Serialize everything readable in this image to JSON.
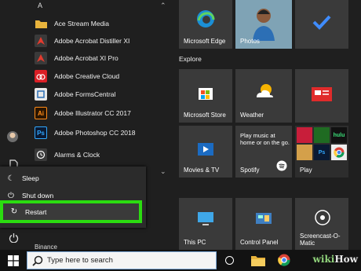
{
  "applist": {
    "letter": "A",
    "apps": [
      {
        "label": "Ace Stream Media",
        "icon": "folder-icon"
      },
      {
        "label": "Adobe Acrobat Distiller XI",
        "icon": "acrobat-distiller-icon"
      },
      {
        "label": "Adobe Acrobat XI Pro",
        "icon": "acrobat-icon"
      },
      {
        "label": "Adobe Creative Cloud",
        "icon": "creative-cloud-icon"
      },
      {
        "label": "Adobe FormsCentral",
        "icon": "forms-central-icon"
      },
      {
        "label": "Adobe Illustrator CC 2017",
        "icon": "illustrator-icon",
        "glyph": "Ai"
      },
      {
        "label": "Adobe Photoshop CC 2018",
        "icon": "photoshop-icon",
        "glyph": "Ps"
      },
      {
        "label": "Alarms & Clock",
        "icon": "alarm-clock-icon"
      }
    ],
    "binance": "Binance"
  },
  "power_menu": {
    "sleep": "Sleep",
    "shutdown": "Shut down",
    "restart": "Restart"
  },
  "tiles": {
    "explore": "Explore",
    "microsoft_edge": "Microsoft Edge",
    "photos": "Photos",
    "microsoft_store": "Microsoft Store",
    "weather": "Weather",
    "movies_tv": "Movies & TV",
    "spotify": "Spotify",
    "spotify_promo": "Play music at home or on the go.",
    "play": "Play",
    "this_pc": "This PC",
    "control_panel": "Control Panel",
    "screencast": "Screencast-O-Matic",
    "hulu": "hulu"
  },
  "taskbar": {
    "search_placeholder": "Type here to search"
  },
  "watermark": {
    "part1": "wiki",
    "part2": "How"
  },
  "colors": {
    "highlight": "#2bdc10",
    "accent": "#0078d7"
  }
}
